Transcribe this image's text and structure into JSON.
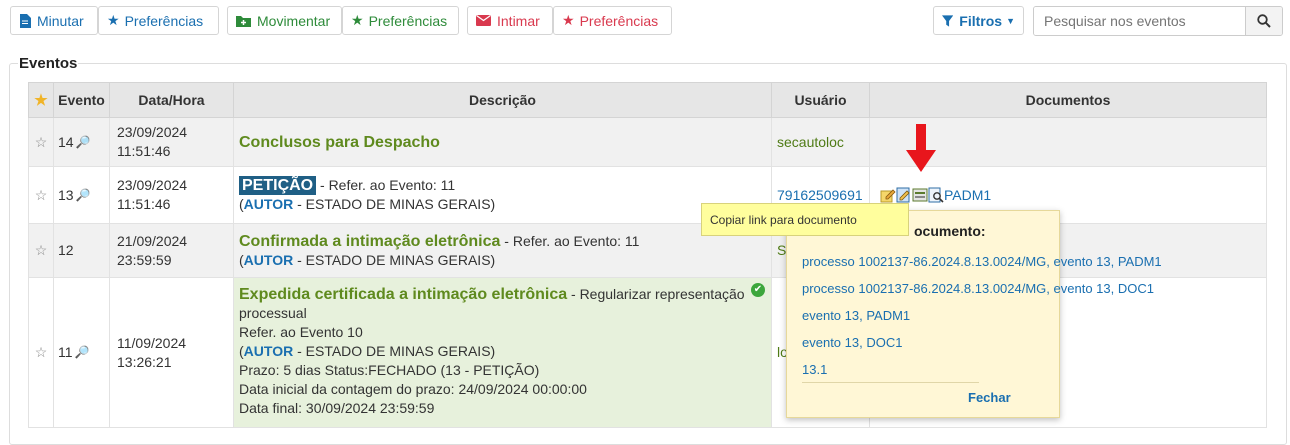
{
  "toolbar": {
    "minutar": "Minutar",
    "pref1": "Preferências",
    "movimentar": "Movimentar",
    "pref2": "Preferências",
    "intimar": "Intimar",
    "pref3": "Preferências",
    "filtros": "Filtros",
    "search_placeholder": "Pesquisar nos eventos"
  },
  "section_title": "Eventos",
  "table": {
    "headers": {
      "evento": "Evento",
      "data": "Data/Hora",
      "descricao": "Descrição",
      "usuario": "Usuário",
      "documentos": "Documentos"
    },
    "rows": [
      {
        "evento": "14",
        "date": "23/09/2024",
        "time": "11:51:46",
        "title": "Conclusos para Despacho",
        "user": "secautoloc"
      },
      {
        "evento": "13",
        "date": "23/09/2024",
        "time": "11:51:46",
        "badge": "PETIÇÃO",
        "refer": "- Refer. ao Evento: 11",
        "autor": "AUTOR",
        "party": "- ESTADO DE MINAS GERAIS)",
        "user": "79162509691",
        "doc": "PADM1"
      },
      {
        "evento": "12",
        "date": "21/09/2024",
        "time": "23:59:59",
        "title": "Confirmada a intimação eletrônica",
        "refer": "- Refer. ao Evento: 11",
        "autor": "AUTOR",
        "party": "- ESTADO DE MINAS GERAIS)",
        "user": "S"
      },
      {
        "evento": "11",
        "date": "11/09/2024",
        "time": "13:26:21",
        "title": "Expedida certificada a intimação eletrônica",
        "subtitle": "- Regularizar representação",
        "line2": "processual",
        "line3": "Refer. ao Evento 10",
        "autor": "AUTOR",
        "party": "- ESTADO DE MINAS GERAIS)",
        "line5": "Prazo: 5 dias Status:FECHADO (13 - PETIÇÃO)",
        "line6": "Data inicial da contagem do prazo: 24/09/2024 00:00:00",
        "line7": "Data final: 30/09/2024 23:59:59",
        "user": "lo"
      }
    ]
  },
  "tooltip": "Copiar link para documento",
  "popup": {
    "title": "ocumento:",
    "links": [
      "processo 1002137-86.2024.8.13.0024/MG, evento 13, PADM1",
      "processo 1002137-86.2024.8.13.0024/MG, evento 13, DOC1",
      "evento 13, PADM1",
      "evento 13, DOC1",
      "13.1"
    ],
    "close": "Fechar"
  },
  "colors": {
    "blue": "#1a6fb0",
    "green": "#2e8b3a",
    "red": "#d9394e",
    "olive": "#5f8a1e",
    "arrow": "#e8161c",
    "popup_bg": "#fff7d6",
    "tooltip_bg": "#fffe9d"
  }
}
